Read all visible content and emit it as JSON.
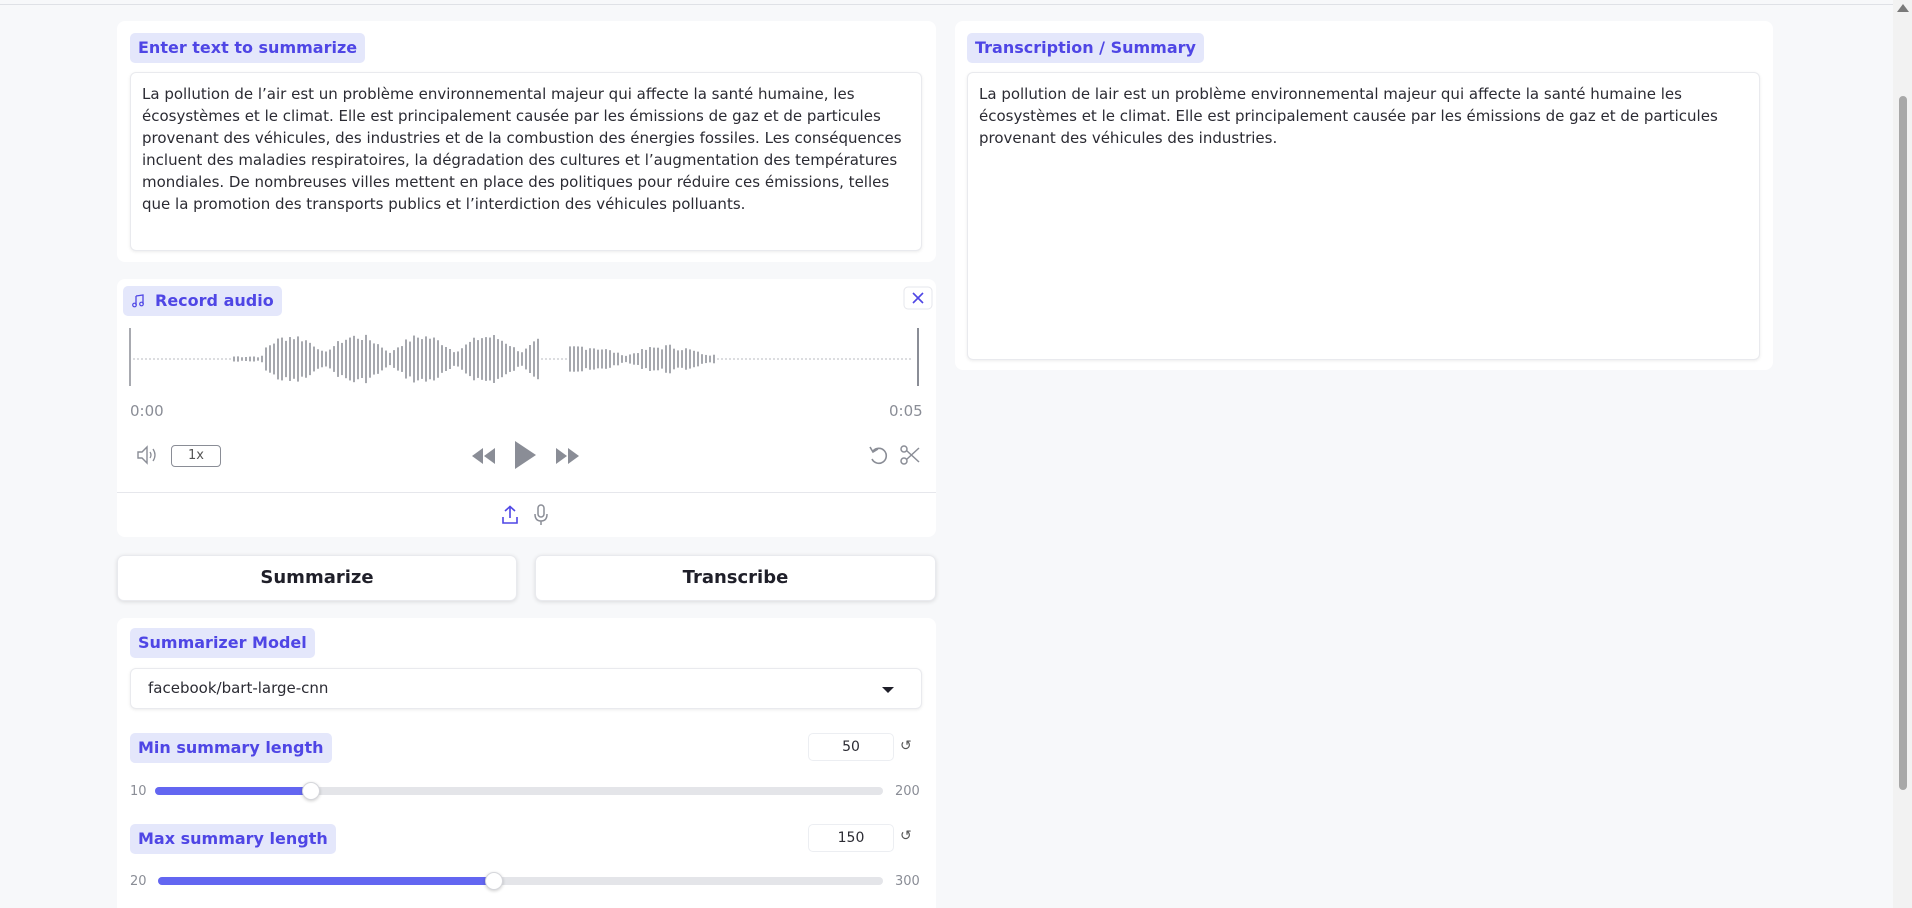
{
  "input": {
    "label": "Enter text to summarize",
    "text": "La pollution de l’air est un problème environnemental majeur qui affecte la santé humaine, les écosystèmes et le climat. Elle est principalement causée par les émissions de gaz et de particules provenant des véhicules, des industries et de la combustion des énergies fossiles. Les conséquences incluent des maladies respiratoires, la dégradation des cultures et l’augmentation des températures mondiales. De nombreuses villes mettent en place des politiques pour réduire ces émissions, telles que la promotion des transports publics et l’interdiction des véhicules polluants."
  },
  "audio": {
    "label": "Record audio",
    "current_time": "0:00",
    "duration": "0:05",
    "playback_rate": "1x",
    "icons": [
      "music-note-icon",
      "close-icon",
      "volume-icon",
      "rewind-icon",
      "play-icon",
      "fast-forward-icon",
      "undo-icon",
      "scissors-icon",
      "upload-icon",
      "microphone-icon"
    ]
  },
  "actions": {
    "summarize": "Summarize",
    "transcribe": "Transcribe"
  },
  "model": {
    "label": "Summarizer Model",
    "selected": "facebook/bart-large-cnn"
  },
  "min_length": {
    "label": "Min summary length",
    "value": "50",
    "min": "10",
    "max": "200"
  },
  "max_length": {
    "label": "Max summary length",
    "value": "150",
    "min": "20",
    "max": "300"
  },
  "output": {
    "label": "Transcription / Summary",
    "text": "La pollution de lair est un problème environnemental majeur qui affecte la santé humaine les écosystèmes et le climat. Elle est principalement causée par les émissions de gaz et de particules provenant des véhicules des industries."
  },
  "colors": {
    "accent": "#6366f1",
    "label_bg": "#e4e7fb",
    "label_text": "#4f46e5"
  }
}
